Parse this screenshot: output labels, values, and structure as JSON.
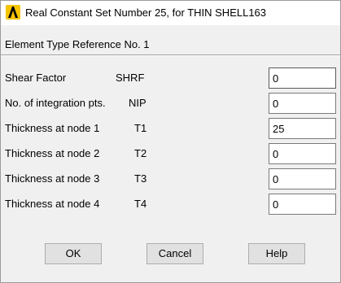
{
  "window": {
    "title": "Real Constant Set Number 25, for THIN SHELL163",
    "icon": "ansys-logo-icon"
  },
  "subheader": "Element Type Reference No. 1",
  "fields": [
    {
      "label": "Shear Factor",
      "code": "SHRF",
      "value": "0"
    },
    {
      "label": "No. of integration pts.",
      "code": "NIP",
      "value": "0"
    },
    {
      "label": "Thickness at node 1",
      "code": "T1",
      "value": "25"
    },
    {
      "label": "Thickness at node 2",
      "code": "T2",
      "value": "0"
    },
    {
      "label": "Thickness at node 3",
      "code": "T3",
      "value": "0"
    },
    {
      "label": "Thickness at node 4",
      "code": "T4",
      "value": "0"
    }
  ],
  "buttons": {
    "ok": "OK",
    "cancel": "Cancel",
    "help": "Help"
  }
}
